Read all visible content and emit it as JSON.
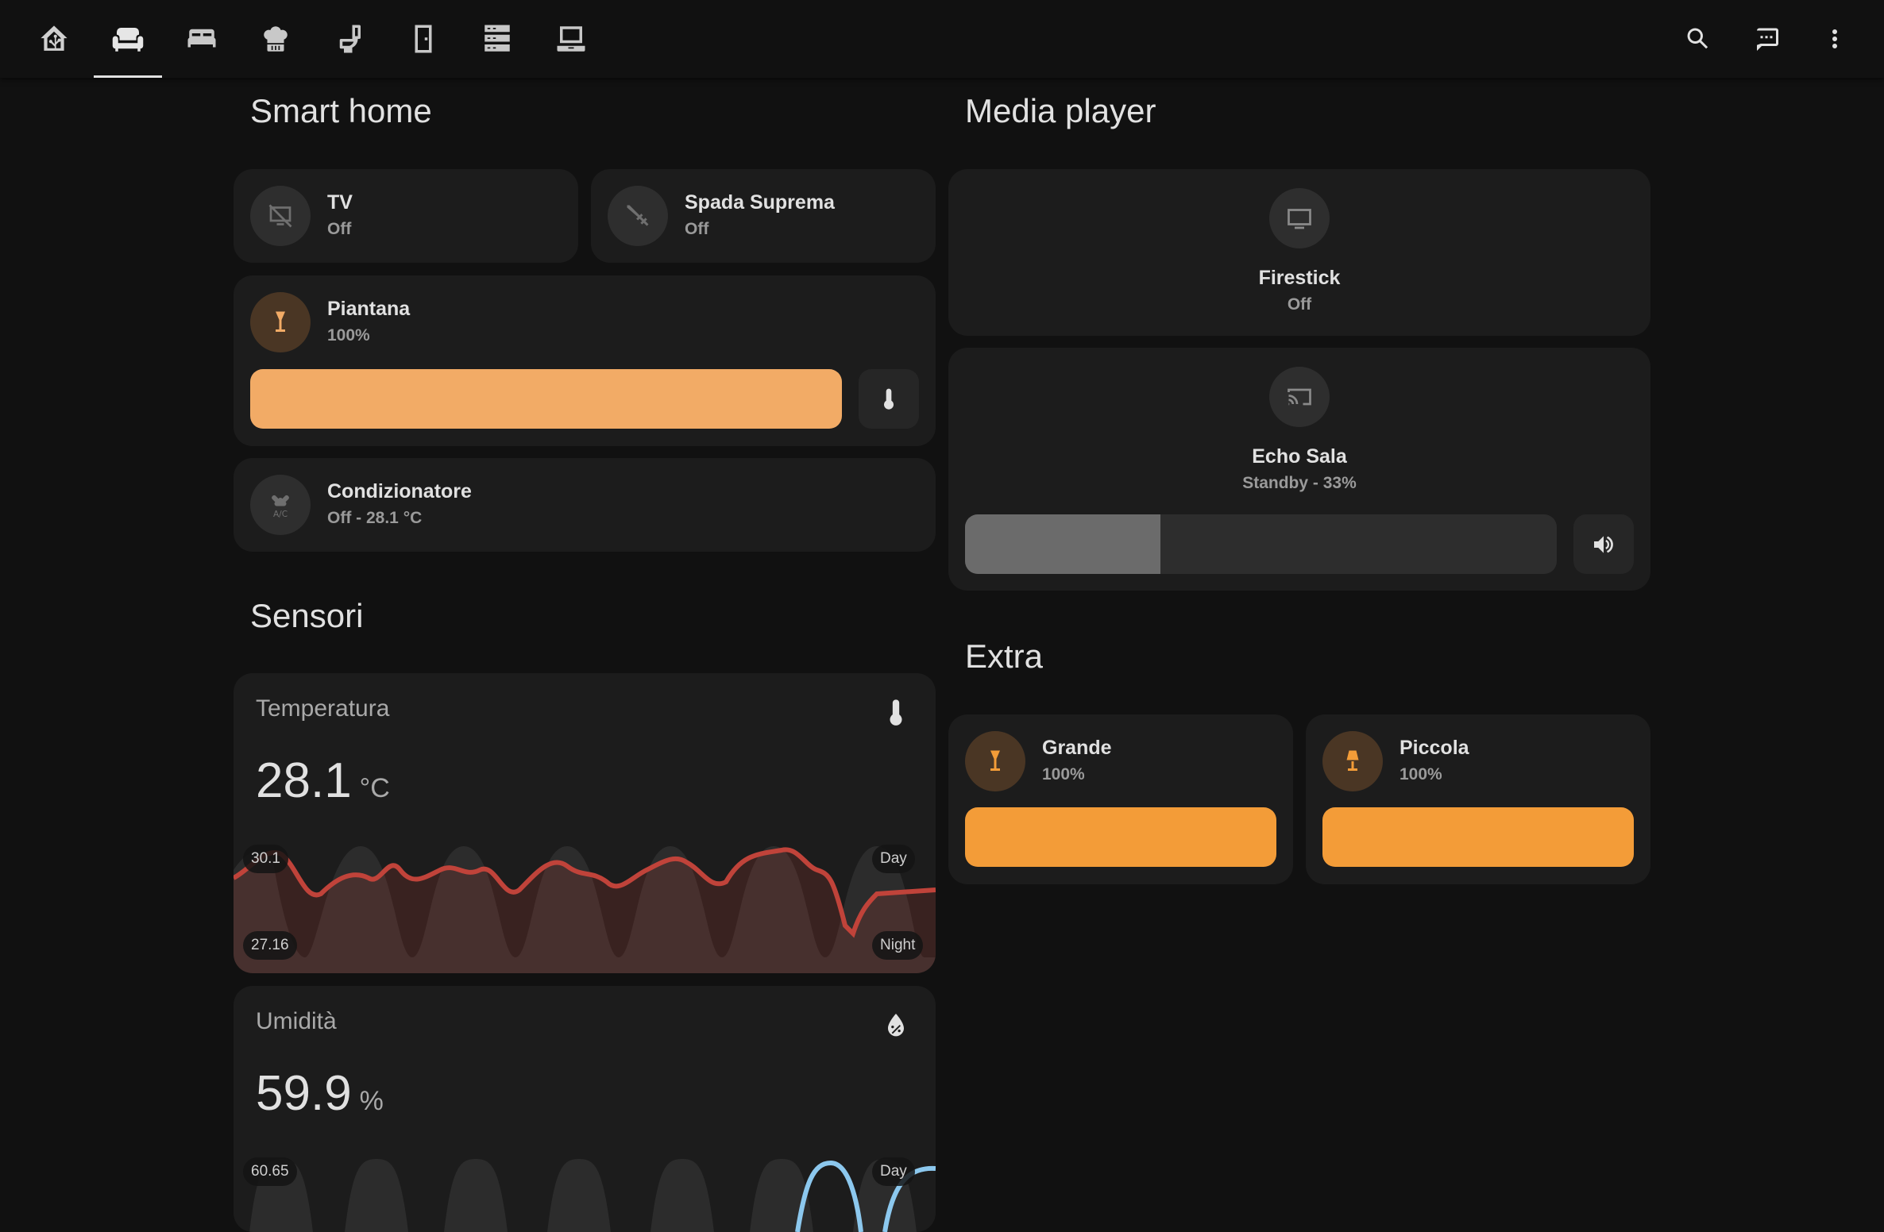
{
  "tabs": [
    {
      "name": "home-assistant-icon"
    },
    {
      "name": "sofa-icon"
    },
    {
      "name": "bed-icon"
    },
    {
      "name": "chef-hat-icon"
    },
    {
      "name": "toilet-icon"
    },
    {
      "name": "door-icon"
    },
    {
      "name": "server-icon"
    },
    {
      "name": "laptop-icon"
    }
  ],
  "active_tab": 1,
  "sections": {
    "smart_home": "Smart home",
    "media_player": "Media player",
    "sensori": "Sensori",
    "extra": "Extra"
  },
  "smart_home": {
    "tv": {
      "name": "TV",
      "state": "Off"
    },
    "spada": {
      "name": "Spada Suprema",
      "state": "Off"
    },
    "piantana": {
      "name": "Piantana",
      "state": "100%",
      "brightness": 1.0,
      "color": "#f2ab66"
    },
    "condizionatore": {
      "name": "Condizionatore",
      "state": "Off - 28.1 °C"
    }
  },
  "media_player": {
    "firestick": {
      "name": "Firestick",
      "state": "Off"
    },
    "echo": {
      "name": "Echo Sala",
      "state": "Standby - 33%",
      "volume": 0.33
    }
  },
  "sensori": {
    "temperatura": {
      "title": "Temperatura",
      "value": "28.1",
      "unit": "°C",
      "max_label": "30.1",
      "min_label": "27.16",
      "day_label": "Day",
      "night_label": "Night",
      "line_color": "#c0433a"
    },
    "umidita": {
      "title": "Umidità",
      "value": "59.9",
      "unit": "%",
      "max_label": "60.65",
      "day_label": "Day",
      "line_color": "#8cc8ee"
    }
  },
  "extra": {
    "grande": {
      "name": "Grande",
      "state": "100%",
      "brightness": 1.0,
      "color": "#f39c38"
    },
    "piccola": {
      "name": "Piccola",
      "state": "100%",
      "brightness": 1.0,
      "color": "#f39c38"
    }
  },
  "colors": {
    "background": "#111111",
    "card": "#1c1c1c",
    "accent_light": "#f2ab66",
    "accent_orange": "#f39c38"
  }
}
